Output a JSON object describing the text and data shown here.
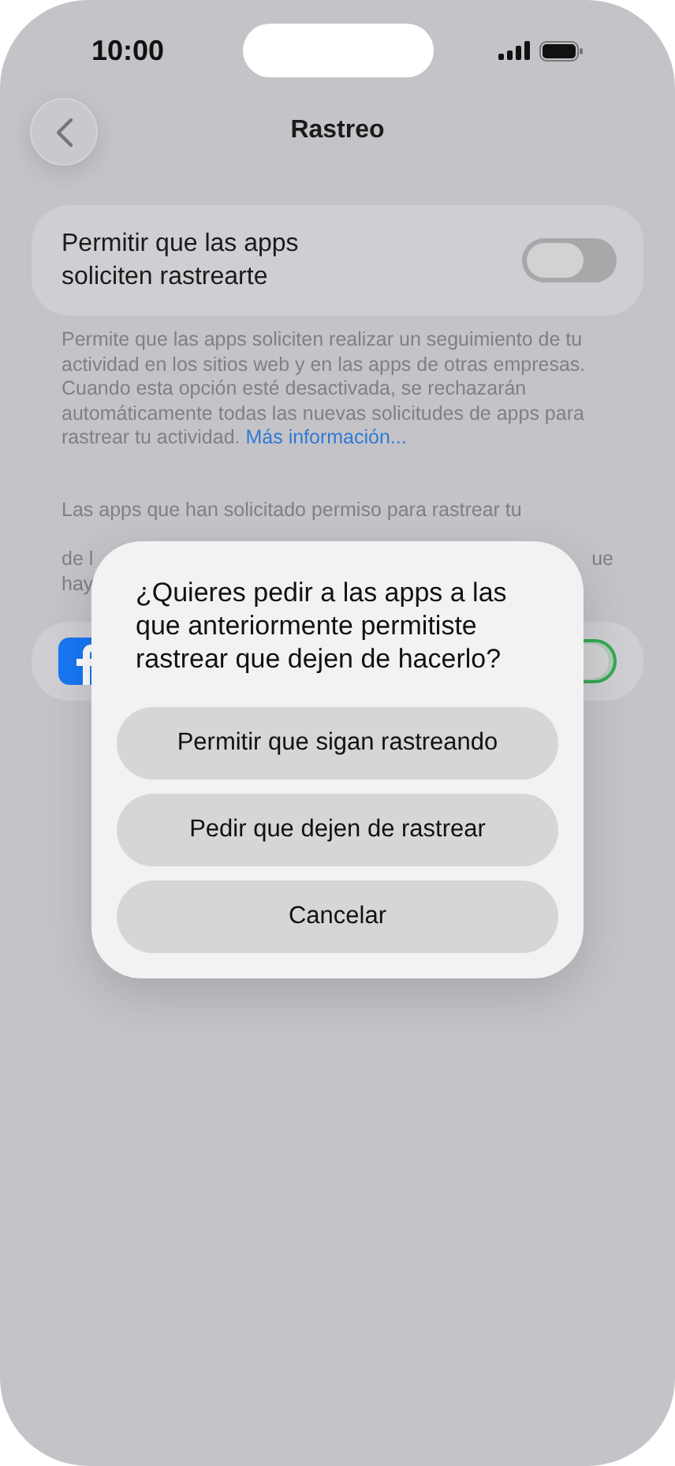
{
  "status_bar": {
    "time": "10:00"
  },
  "header": {
    "title": "Rastreo"
  },
  "setting": {
    "label": "Permitir que las apps soliciten rastrearte",
    "on": false
  },
  "description": {
    "text": "Permite que las apps soliciten realizar un seguimiento de tu actividad en los sitios web y en las apps de otras empresas. Cuando esta opción esté desactivada, se rechazarán automáticamente todas las nuevas solicitudes de apps para rastrear tu actividad.",
    "link": "Más información..."
  },
  "apps_note": {
    "first_line": "Las apps que han solicitado permiso para rastrear tu",
    "left_fragments": [
      "de l",
      "hay"
    ],
    "right_fragments": [
      "ue"
    ]
  },
  "apps": [
    {
      "on": true
    }
  ],
  "dialog": {
    "message": "¿Quieres pedir a las apps a las que anteriormente permitiste rastrear que dejen de hacerlo?",
    "buttons": [
      "Permitir que sigan rastreando",
      "Pedir que dejen de rastrear",
      "Cancelar"
    ]
  }
}
